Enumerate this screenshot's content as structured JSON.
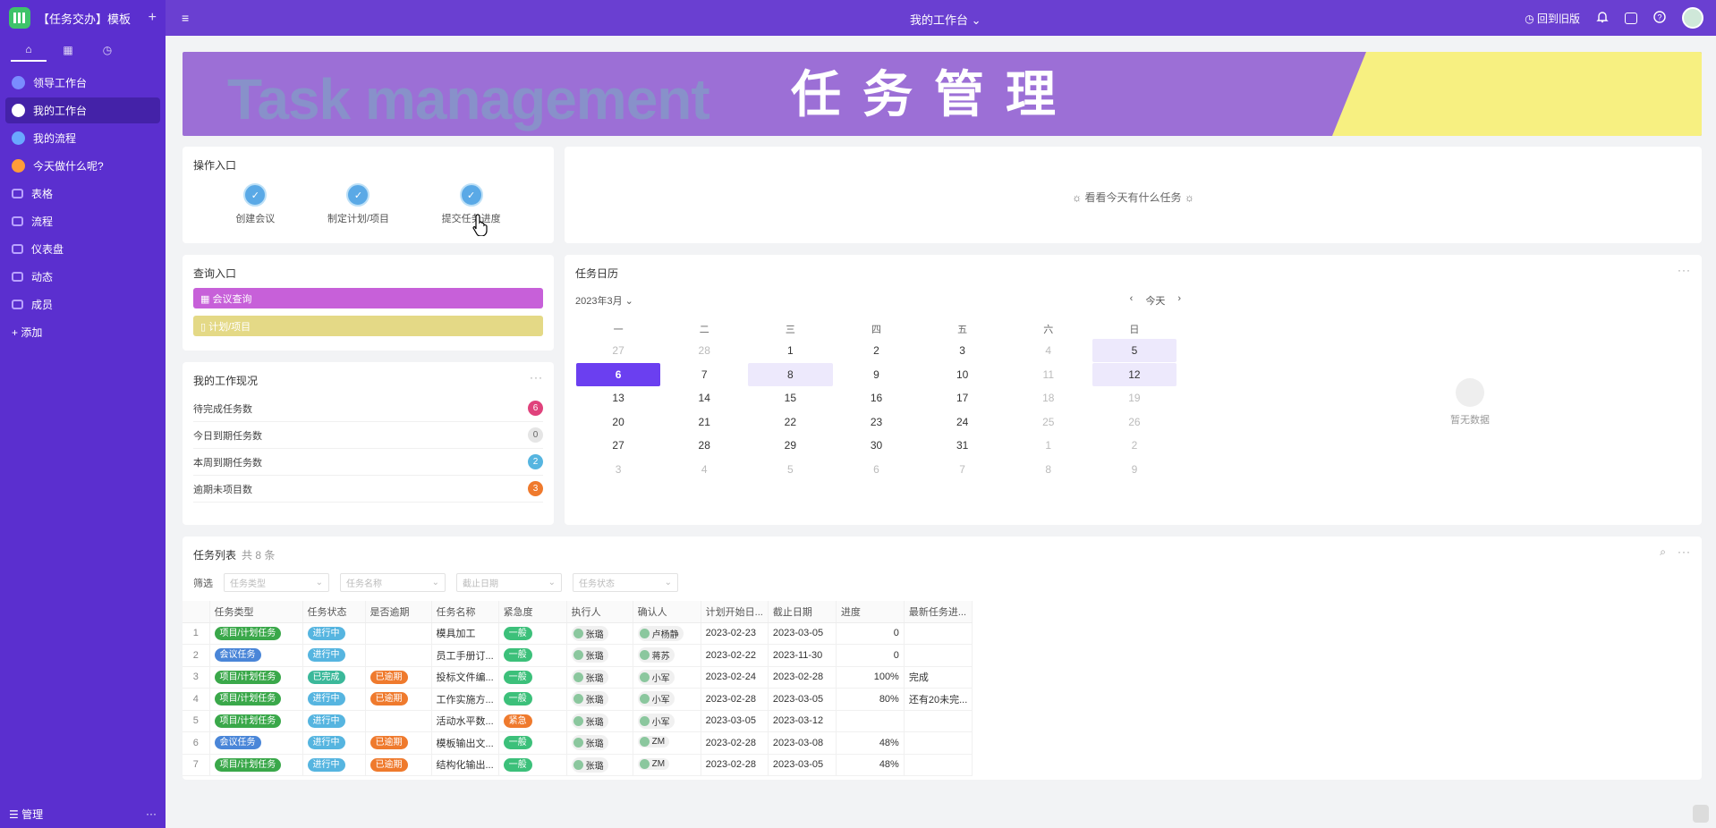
{
  "app": {
    "title": "【任务交办】模板",
    "add": "+"
  },
  "sidebar": {
    "tabs": [
      {
        "icon": "home-icon",
        "label": "⌂"
      },
      {
        "icon": "grid-icon",
        "label": "▦"
      },
      {
        "icon": "clock-icon",
        "label": "◷"
      }
    ],
    "items": [
      {
        "label": "领导工作台",
        "color": "#7a8cff"
      },
      {
        "label": "我的工作台",
        "color": "#ffffff",
        "active": true
      },
      {
        "label": "我的流程",
        "color": "#6aa8ff"
      },
      {
        "label": "今天做什么呢?",
        "color": "#ff9c3a"
      },
      {
        "label": "表格",
        "color": "#b9a2ff"
      },
      {
        "label": "流程",
        "color": "#b9a2ff"
      },
      {
        "label": "仪表盘",
        "color": "#b9a2ff"
      },
      {
        "label": "动态",
        "color": "#b9a2ff"
      },
      {
        "label": "成员",
        "color": "#b9a2ff"
      }
    ],
    "add_label": "+ 添加",
    "footer": {
      "manage": "☰ 管理",
      "more": "···"
    }
  },
  "topbar": {
    "title": "我的工作台 ⌄",
    "back_label": "◷ 回到旧版",
    "menu": "≡"
  },
  "banner": {
    "en": "Task management",
    "cn": "任务管理"
  },
  "ops": {
    "title": "操作入口",
    "items": [
      {
        "label": "创建会议",
        "icon": "calendar-icon"
      },
      {
        "label": "制定计划/项目",
        "icon": "copy-icon"
      },
      {
        "label": "提交任务进度",
        "icon": "check-icon"
      }
    ]
  },
  "today": {
    "text": "☼ 看看今天有什么任务 ☼"
  },
  "query": {
    "title": "查询入口",
    "buttons": [
      {
        "label": "▦ 会议查询",
        "color": "#c760d9"
      },
      {
        "label": "▯ 计划/项目",
        "color": "#e4d986"
      }
    ]
  },
  "status": {
    "title": "我的工作现况",
    "more": "···",
    "rows": [
      {
        "label": "待完成任务数",
        "value": "6",
        "color": "#e0427c"
      },
      {
        "label": "今日到期任务数",
        "value": "0",
        "color": "#e5e5e5"
      },
      {
        "label": "本周到期任务数",
        "value": "2",
        "color": "#56b5e0"
      },
      {
        "label": "逾期未项目数",
        "value": "3",
        "color": "#ef7a2d"
      }
    ]
  },
  "calendar": {
    "title": "任务日历",
    "more": "···",
    "month": "2023年3月 ⌄",
    "prev": "‹",
    "today": "今天",
    "next": "›",
    "weekdays": [
      "一",
      "二",
      "三",
      "四",
      "五",
      "六",
      "日"
    ],
    "weeks": [
      [
        [
          "27",
          "dim"
        ],
        [
          "28",
          "dim"
        ],
        [
          "1",
          ""
        ],
        [
          "2",
          ""
        ],
        [
          "3",
          ""
        ],
        [
          "4",
          "dim"
        ],
        [
          "5",
          "hl"
        ]
      ],
      [
        [
          "6",
          "sel"
        ],
        [
          "7",
          ""
        ],
        [
          "8",
          "hl"
        ],
        [
          "9",
          ""
        ],
        [
          "10",
          ""
        ],
        [
          "11",
          "dim"
        ],
        [
          "12",
          "hl"
        ]
      ],
      [
        [
          "13",
          ""
        ],
        [
          "14",
          ""
        ],
        [
          "15",
          ""
        ],
        [
          "16",
          ""
        ],
        [
          "17",
          ""
        ],
        [
          "18",
          "dim"
        ],
        [
          "19",
          "dim"
        ]
      ],
      [
        [
          "20",
          ""
        ],
        [
          "21",
          ""
        ],
        [
          "22",
          ""
        ],
        [
          "23",
          ""
        ],
        [
          "24",
          ""
        ],
        [
          "25",
          "dim"
        ],
        [
          "26",
          "dim"
        ]
      ],
      [
        [
          "27",
          ""
        ],
        [
          "28",
          ""
        ],
        [
          "29",
          ""
        ],
        [
          "30",
          ""
        ],
        [
          "31",
          ""
        ],
        [
          "1",
          "dim"
        ],
        [
          "2",
          "dim"
        ]
      ],
      [
        [
          "3",
          "dim"
        ],
        [
          "4",
          "dim"
        ],
        [
          "5",
          "dim"
        ],
        [
          "6",
          "dim"
        ],
        [
          "7",
          "dim"
        ],
        [
          "8",
          "dim"
        ],
        [
          "9",
          "dim"
        ]
      ]
    ],
    "empty": "暂无数据"
  },
  "task_list": {
    "title": "任务列表",
    "count": "共 8 条",
    "filter_label": "筛选",
    "filters": [
      "任务类型",
      "任务名称",
      "截止日期",
      "任务状态"
    ],
    "columns": [
      "",
      "任务类型",
      "任务状态",
      "是否逾期",
      "任务名称",
      "紧急度",
      "执行人",
      "确认人",
      "计划开始日...",
      "截止日期",
      "进度",
      "最新任务进..."
    ],
    "rows": [
      {
        "n": "1",
        "type": "项目/计划任务",
        "status": "进行中",
        "overdue": "",
        "name": "模具加工",
        "urgency": "一般",
        "exec": "张璐",
        "confirm": "卢杨静",
        "start": "2023-02-23",
        "end": "2023-03-05",
        "progress": "0",
        "latest": ""
      },
      {
        "n": "2",
        "type": "会议任务",
        "status": "进行中",
        "overdue": "",
        "name": "员工手册订...",
        "urgency": "一般",
        "exec": "张璐",
        "confirm": "蒋苏",
        "start": "2023-02-22",
        "end": "2023-11-30",
        "progress": "0",
        "latest": ""
      },
      {
        "n": "3",
        "type": "项目/计划任务",
        "status": "已完成",
        "overdue": "已逾期",
        "name": "投标文件编...",
        "urgency": "一般",
        "exec": "张璐",
        "confirm": "小军",
        "start": "2023-02-24",
        "end": "2023-02-28",
        "progress": "100%",
        "latest": "完成"
      },
      {
        "n": "4",
        "type": "项目/计划任务",
        "status": "进行中",
        "overdue": "已逾期",
        "name": "工作实施方...",
        "urgency": "一般",
        "exec": "张璐",
        "confirm": "小军",
        "start": "2023-02-28",
        "end": "2023-03-05",
        "progress": "80%",
        "latest": "还有20未完..."
      },
      {
        "n": "5",
        "type": "项目/计划任务",
        "status": "进行中",
        "overdue": "",
        "name": "活动水平数...",
        "urgency": "紧急",
        "exec": "张璐",
        "confirm": "小军",
        "start": "2023-03-05",
        "end": "2023-03-12",
        "progress": "",
        "latest": ""
      },
      {
        "n": "6",
        "type": "会议任务",
        "status": "进行中",
        "overdue": "已逾期",
        "name": "模板输出文...",
        "urgency": "一般",
        "exec": "张璐",
        "confirm": "ZM",
        "start": "2023-02-28",
        "end": "2023-03-08",
        "progress": "48%",
        "latest": ""
      },
      {
        "n": "7",
        "type": "项目/计划任务",
        "status": "进行中",
        "overdue": "已逾期",
        "name": "结构化输出...",
        "urgency": "一般",
        "exec": "张璐",
        "confirm": "ZM",
        "start": "2023-02-28",
        "end": "2023-03-05",
        "progress": "48%",
        "latest": ""
      }
    ]
  },
  "colors": {
    "type_project": "#3aa84a",
    "type_meeting": "#4a86d8",
    "status_doing": "#56b5e0",
    "status_done": "#3bb89a",
    "overdue": "#ef7a2d",
    "urgency_normal": "#3cc07a",
    "urgency_urgent": "#ef7a2d"
  }
}
